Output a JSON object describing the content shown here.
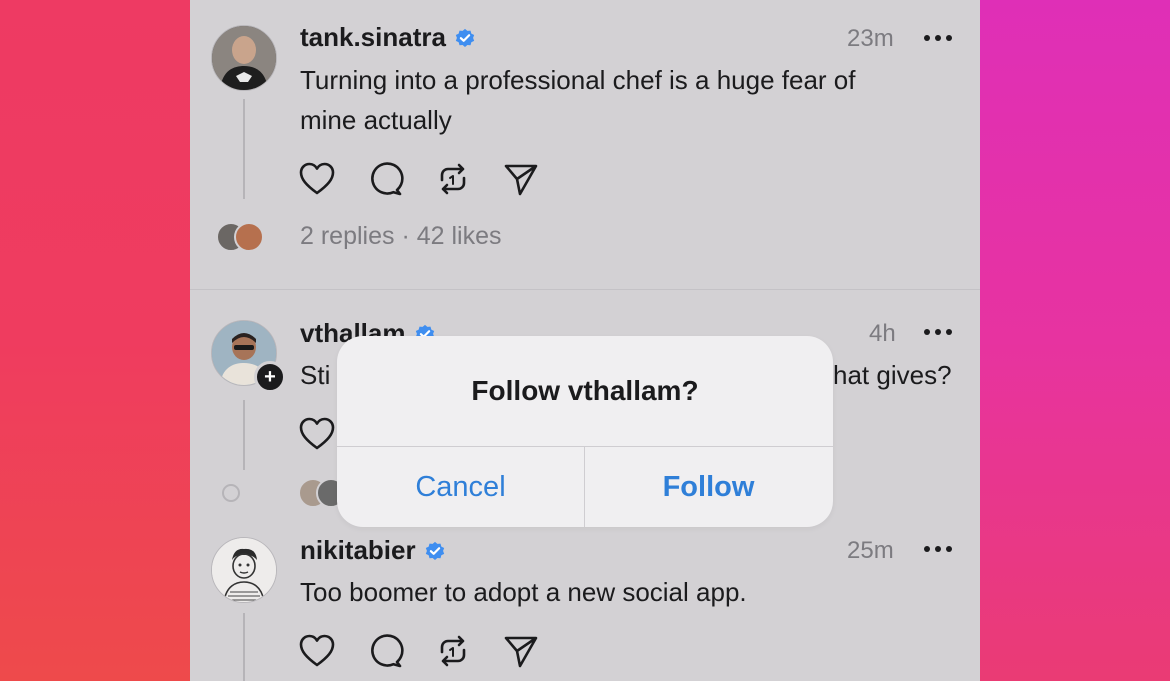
{
  "posts": [
    {
      "username": "tank.sinatra",
      "time": "23m",
      "text_line1": "Turning into a professional chef is a huge fear of",
      "text_line2": "mine actually",
      "stats": "2 replies · 42 likes"
    },
    {
      "username": "vthallam",
      "time": "4h",
      "text_start": "Sti",
      "text_end": "hat gives?"
    },
    {
      "username": "nikitabier",
      "time": "25m",
      "text_line1": "Too boomer to adopt a new social app."
    }
  ],
  "dialog": {
    "title": "Follow vthallam?",
    "cancel_label": "Cancel",
    "follow_label": "Follow"
  },
  "icons": {
    "like": "heart-icon",
    "reply": "comment-icon",
    "repost": "repost-icon",
    "share": "send-icon",
    "more": "more-dots-icon",
    "verified": "verified-badge-icon",
    "follow": "plus-icon"
  },
  "colors": {
    "verified": "#3f8ef0",
    "dialog_button": "#2f7fd8",
    "background_left": "#ee3d62",
    "background_right": "#d934b6"
  }
}
